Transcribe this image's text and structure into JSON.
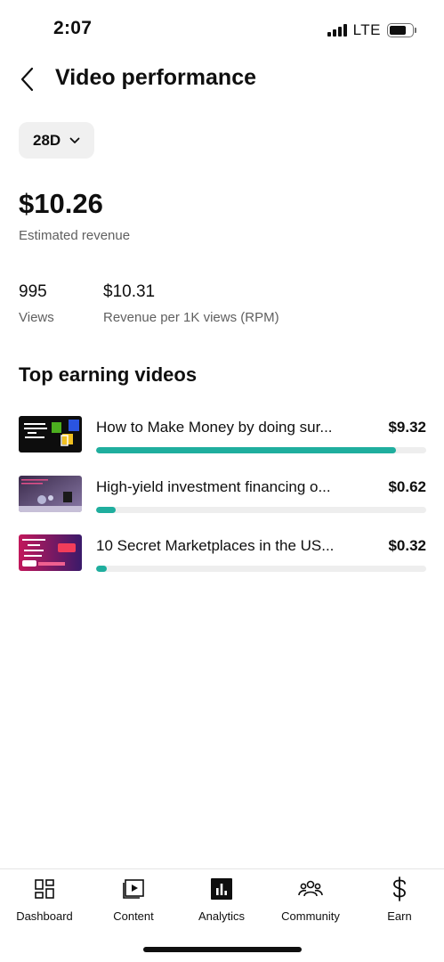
{
  "status_bar": {
    "time": "2:07",
    "network": "LTE"
  },
  "header": {
    "title": "Video performance",
    "back_icon": "chevron-left-icon"
  },
  "period_selector": {
    "label": "28D",
    "icon": "chevron-down-icon"
  },
  "summary": {
    "revenue_value": "$10.26",
    "revenue_label": "Estimated revenue",
    "stats": [
      {
        "value": "995",
        "label": "Views"
      },
      {
        "value": "$10.31",
        "label": "Revenue per 1K views (RPM)"
      }
    ]
  },
  "top_videos": {
    "title": "Top earning videos",
    "accent_color": "#1fae9e",
    "items": [
      {
        "title": "How to Make Money by doing sur...",
        "amount": "$9.32",
        "share": 0.908,
        "thumb_style": "dark"
      },
      {
        "title": "High-yield investment financing o...",
        "amount": "$0.62",
        "share": 0.06,
        "thumb_style": "purple"
      },
      {
        "title": "10 Secret Marketplaces in the US...",
        "amount": "$0.32",
        "share": 0.031,
        "thumb_style": "magenta"
      }
    ]
  },
  "bottom_nav": {
    "items": [
      {
        "label": "Dashboard",
        "icon": "dashboard-icon"
      },
      {
        "label": "Content",
        "icon": "content-icon"
      },
      {
        "label": "Analytics",
        "icon": "analytics-icon",
        "active": true
      },
      {
        "label": "Community",
        "icon": "community-icon"
      },
      {
        "label": "Earn",
        "icon": "dollar-icon"
      }
    ]
  }
}
